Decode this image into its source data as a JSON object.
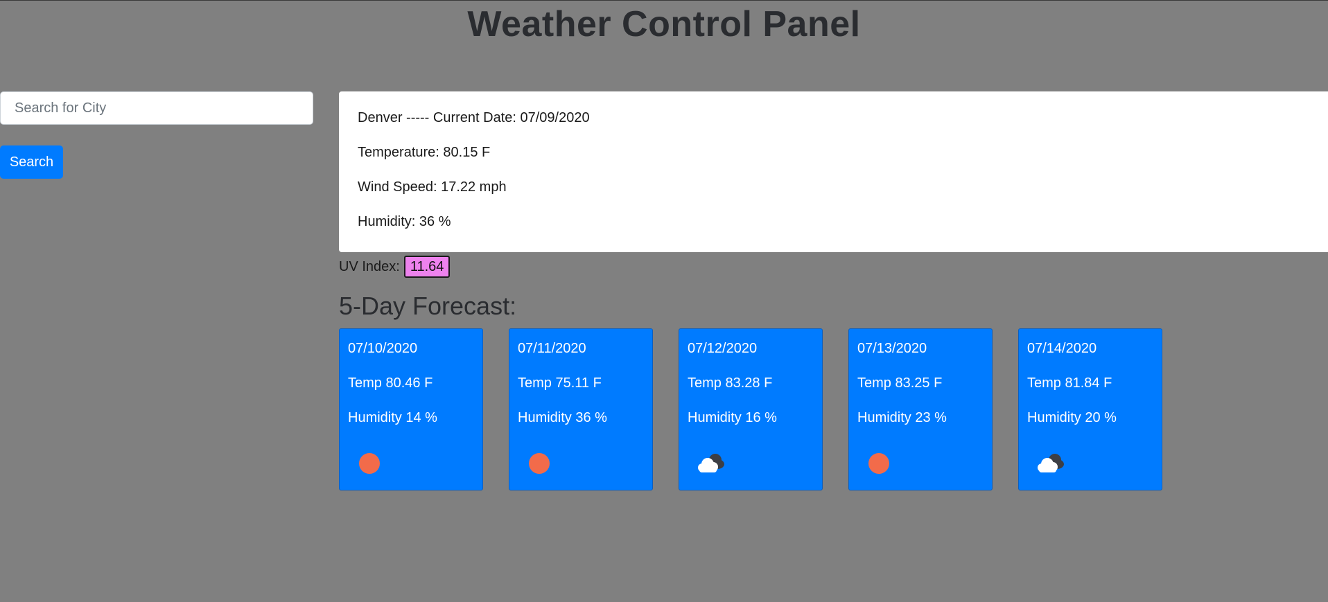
{
  "header": {
    "title": "Weather Control Panel"
  },
  "search": {
    "placeholder": "Search for City",
    "value": "",
    "button_label": "Search"
  },
  "current": {
    "heading": "Denver ----- Current Date: 07/09/2020",
    "temperature": "Temperature: 80.15 F",
    "wind": "Wind Speed: 17.22 mph",
    "humidity": "Humidity: 36 %",
    "uv_label": "UV Index:",
    "uv_value": "11.64",
    "uv_color": "#ee82ee"
  },
  "forecast": {
    "title": "5-Day Forecast:",
    "days": [
      {
        "date": "07/10/2020",
        "temp": "Temp 80.46 F",
        "humidity": "Humidity 14 %",
        "icon": "sun-icon"
      },
      {
        "date": "07/11/2020",
        "temp": "Temp 75.11 F",
        "humidity": "Humidity 36 %",
        "icon": "sun-icon"
      },
      {
        "date": "07/12/2020",
        "temp": "Temp 83.28 F",
        "humidity": "Humidity 16 %",
        "icon": "cloud-icon"
      },
      {
        "date": "07/13/2020",
        "temp": "Temp 83.25 F",
        "humidity": "Humidity 23 %",
        "icon": "sun-icon"
      },
      {
        "date": "07/14/2020",
        "temp": "Temp 81.84 F",
        "humidity": "Humidity 20 %",
        "icon": "cloud-icon"
      }
    ]
  },
  "colors": {
    "background": "#808080",
    "primary": "#007bff",
    "sun": "#f26b4a"
  }
}
